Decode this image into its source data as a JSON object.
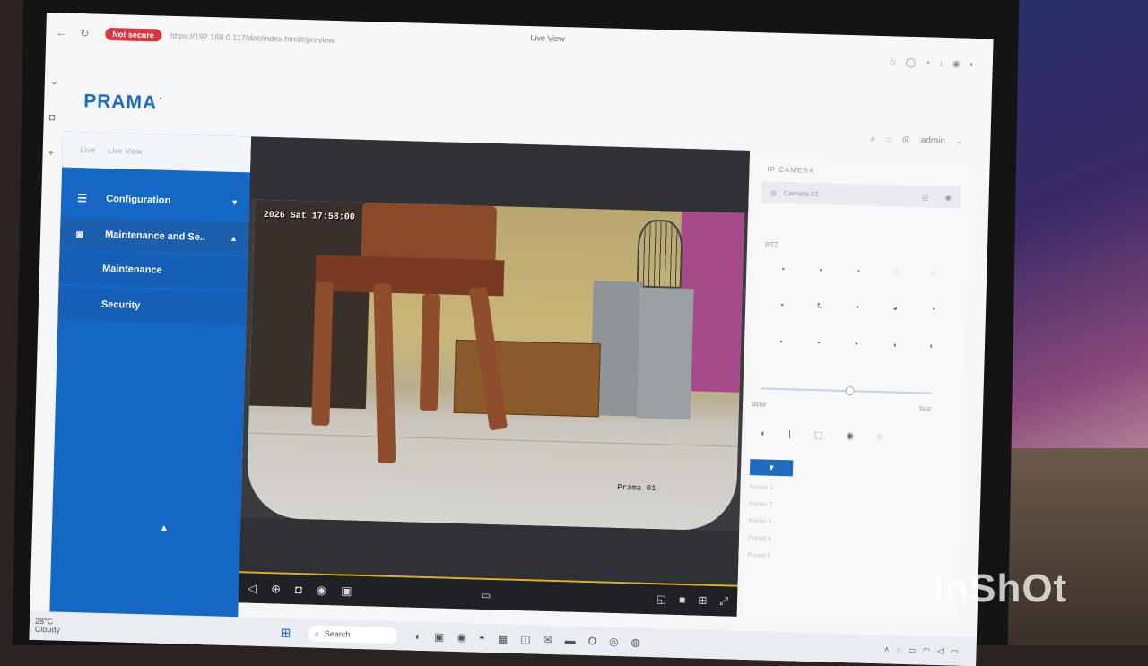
{
  "browser": {
    "not_secure": "Not secure",
    "url": "https://192.168.0.117/doc/index.html#/preview",
    "tab_title": "Live View",
    "back_icon": "←",
    "reload_icon": "↻",
    "tools": [
      "☆",
      "◯",
      "◔",
      "↓",
      "◉",
      "◐"
    ]
  },
  "app": {
    "logo": "PRAMA",
    "user": "admin"
  },
  "sidebar": {
    "top_labels": [
      "Live",
      "Live View"
    ],
    "config_label": "Configuration",
    "maint_label": "Maintenance and Se..",
    "sub_items": [
      "Maintenance",
      "Security"
    ]
  },
  "video": {
    "osd_time": "2026 Sat 17:58:00",
    "osd_name": "Prama 01"
  },
  "panel": {
    "title": "IP CAMERA",
    "camera": "Camera 01",
    "ptz_label": "PTZ",
    "slider_min": "slow",
    "slider_max": "fast",
    "presets": [
      "Preset 1",
      "Preset 2",
      "Preset 3",
      "Preset 4",
      "Preset 5"
    ]
  },
  "taskbar": {
    "temp": "28°C",
    "weather": "Cloudy",
    "search": "Search"
  },
  "watermark": "InShOt",
  "colors": {
    "accent": "#1467c4",
    "not_secure": "#d9363e",
    "progress_line": "#e0b020"
  }
}
